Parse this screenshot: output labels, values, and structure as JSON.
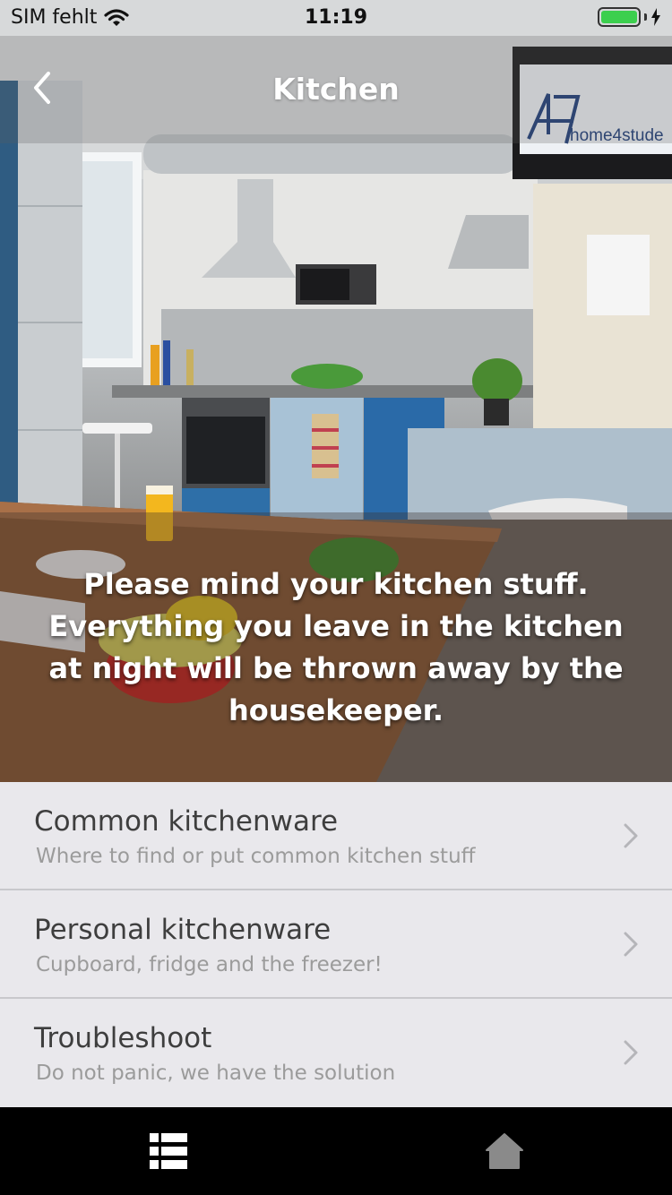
{
  "status_bar": {
    "carrier": "SIM fehlt",
    "time": "11:19",
    "battery_level": 1.0,
    "battery_color": "#3ccf4e",
    "wifi_icon": "wifi-icon",
    "charging_icon": "bolt-icon"
  },
  "nav": {
    "title": "Kitchen",
    "back_icon": "chevron-left-icon"
  },
  "hero": {
    "tv_logo_text": "home4stude",
    "notice": "Please mind your kitchen stuff. Everything you leave in the kitchen at night will be thrown away by the housekeeper."
  },
  "menu": {
    "items": [
      {
        "title": "Common kitchenware",
        "subtitle": "Where to find or put common kitchen stuff",
        "icon": "chevron-right-icon"
      },
      {
        "title": "Personal kitchenware",
        "subtitle": "Cupboard, fridge and the freezer!",
        "icon": "chevron-right-icon"
      },
      {
        "title": "Troubleshoot",
        "subtitle": "Do not panic, we have the solution",
        "icon": "chevron-right-icon"
      }
    ]
  },
  "tab_bar": {
    "tabs": [
      {
        "icon": "list-icon",
        "active": true,
        "color": "#ffffff"
      },
      {
        "icon": "home-icon",
        "active": false,
        "color": "#8a8a8a"
      }
    ]
  }
}
